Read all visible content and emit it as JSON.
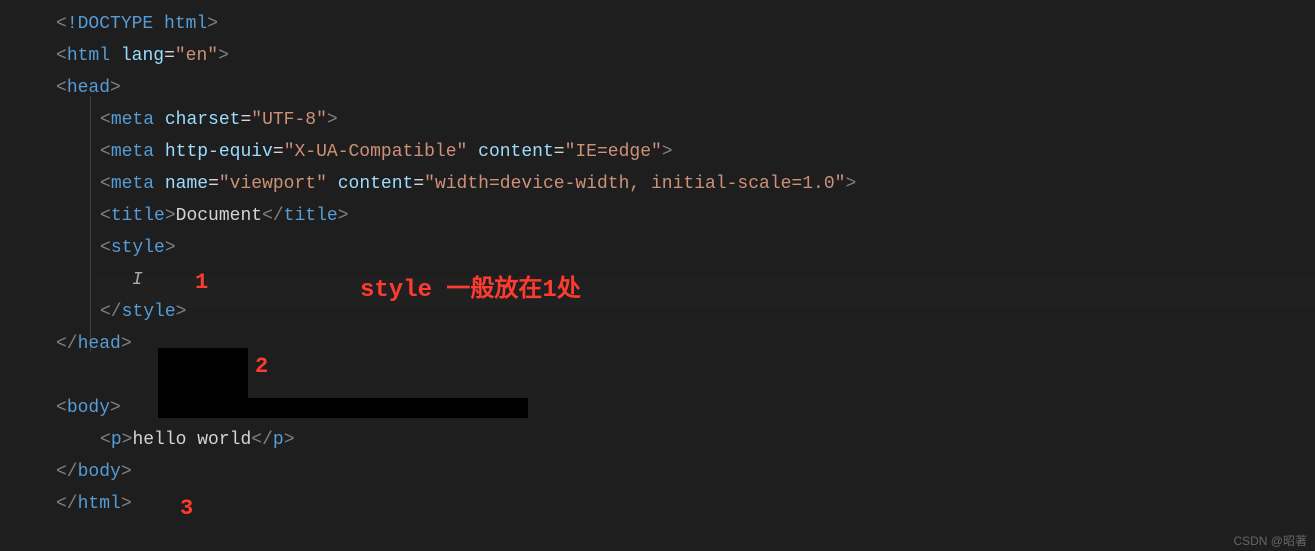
{
  "code": {
    "l1_doctype": "!DOCTYPE",
    "l1_html": " html",
    "l2_tag": "html",
    "l2_attr": "lang",
    "l2_val": "\"en\"",
    "l3_tag": "head",
    "l4_tag": "meta",
    "l4_attr": "charset",
    "l4_val": "\"UTF-8\"",
    "l5_tag": "meta",
    "l5_attr1": "http-equiv",
    "l5_val1": "\"X-UA-Compatible\"",
    "l5_attr2": "content",
    "l5_val2": "\"IE=edge\"",
    "l6_tag": "meta",
    "l6_attr1": "name",
    "l6_val1": "\"viewport\"",
    "l6_attr2": "content",
    "l6_val2": "\"width=device-width, initial-scale=1.0\"",
    "l7_tag": "title",
    "l7_text": "Document",
    "l8_tag": "style",
    "l10_tag": "style",
    "l11_tag": "head",
    "l13_tag": "body",
    "l14_tag": "p",
    "l14_text": "hello world",
    "l15_tag": "body",
    "l16_tag": "html"
  },
  "anno": {
    "n1": "1",
    "n2": "2",
    "n3": "3",
    "text": "style   一般放在1处"
  },
  "watermark": "CSDN @昭著"
}
